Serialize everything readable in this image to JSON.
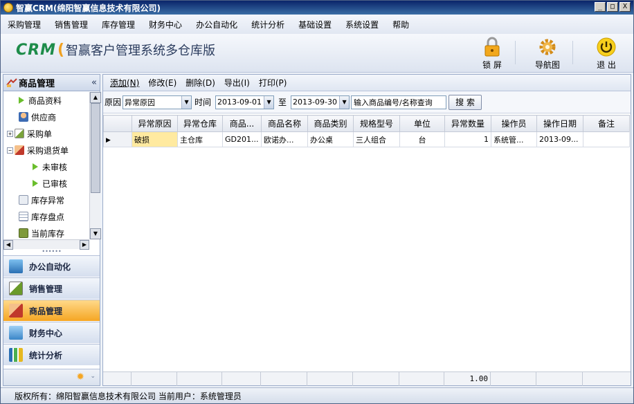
{
  "window": {
    "title": "智赢CRM(绵阳智赢信息技术有限公司)",
    "controls": [
      "_",
      "□",
      "X"
    ]
  },
  "menu": [
    "采购管理",
    "销售管理",
    "库存管理",
    "财务中心",
    "办公自动化",
    "统计分析",
    "基础设置",
    "系统设置",
    "帮助"
  ],
  "header": {
    "logo_crm": "CRM",
    "logo_text": "智赢客户管理系统多仓库版",
    "buttons": [
      {
        "label": "锁 屏",
        "icon": "lock-icon"
      },
      {
        "label": "导航图",
        "icon": "gear-icon"
      },
      {
        "label": "退 出",
        "icon": "power-icon"
      }
    ]
  },
  "sidebar": {
    "title": "商品管理",
    "collapse": "«",
    "tree": [
      {
        "label": "商品资料",
        "type": "leaf-arrow"
      },
      {
        "label": "供应商",
        "type": "leaf-icon"
      },
      {
        "label": "采购单",
        "type": "expand",
        "exp": "+"
      },
      {
        "label": "采购退货单",
        "type": "expand",
        "exp": "−"
      },
      {
        "label": "未审核",
        "type": "child-arrow"
      },
      {
        "label": "已审核",
        "type": "child-arrow"
      },
      {
        "label": "库存异常",
        "type": "leaf-icon"
      },
      {
        "label": "库存盘点",
        "type": "leaf-icon"
      },
      {
        "label": "当前库存",
        "type": "leaf-icon"
      }
    ],
    "dots": "••••••",
    "nav": [
      {
        "label": "办公自动化",
        "active": false
      },
      {
        "label": "销售管理",
        "active": false
      },
      {
        "label": "商品管理",
        "active": true
      },
      {
        "label": "财务中心",
        "active": false
      },
      {
        "label": "统计分析",
        "active": false
      }
    ]
  },
  "toolbar": {
    "add": "添加(N)",
    "edit": "修改(E)",
    "delete": "删除(D)",
    "export": "导出(I)",
    "print": "打印(P)"
  },
  "filter": {
    "reason_label": "原因",
    "reason_value": "异常原因",
    "time_label": "时间",
    "date_from": "2013-09-01",
    "to_label": "至",
    "date_to": "2013-09-30",
    "search_value": "输入商品编号/名称查询",
    "search_button": "搜 索"
  },
  "table": {
    "columns": [
      "异常原因",
      "异常仓库",
      "商品...",
      "商品名称",
      "商品类别",
      "规格型号",
      "单位",
      "异常数量",
      "操作员",
      "操作日期",
      "备注"
    ],
    "rows": [
      [
        "破损",
        "主仓库",
        "GD201...",
        "欧诺办...",
        "办公桌",
        "三人组合",
        "台",
        "1",
        "系统管...",
        "2013-09...",
        ""
      ]
    ],
    "summary_quantity": "1.00"
  },
  "status": {
    "text": "版权所有：绵阳智赢信息技术有限公司  当前用户：系统管理员"
  },
  "colors": {
    "titlebar": "#0a246a",
    "active_nav": "#f5a623",
    "brand_green": "#1e8c4a"
  }
}
